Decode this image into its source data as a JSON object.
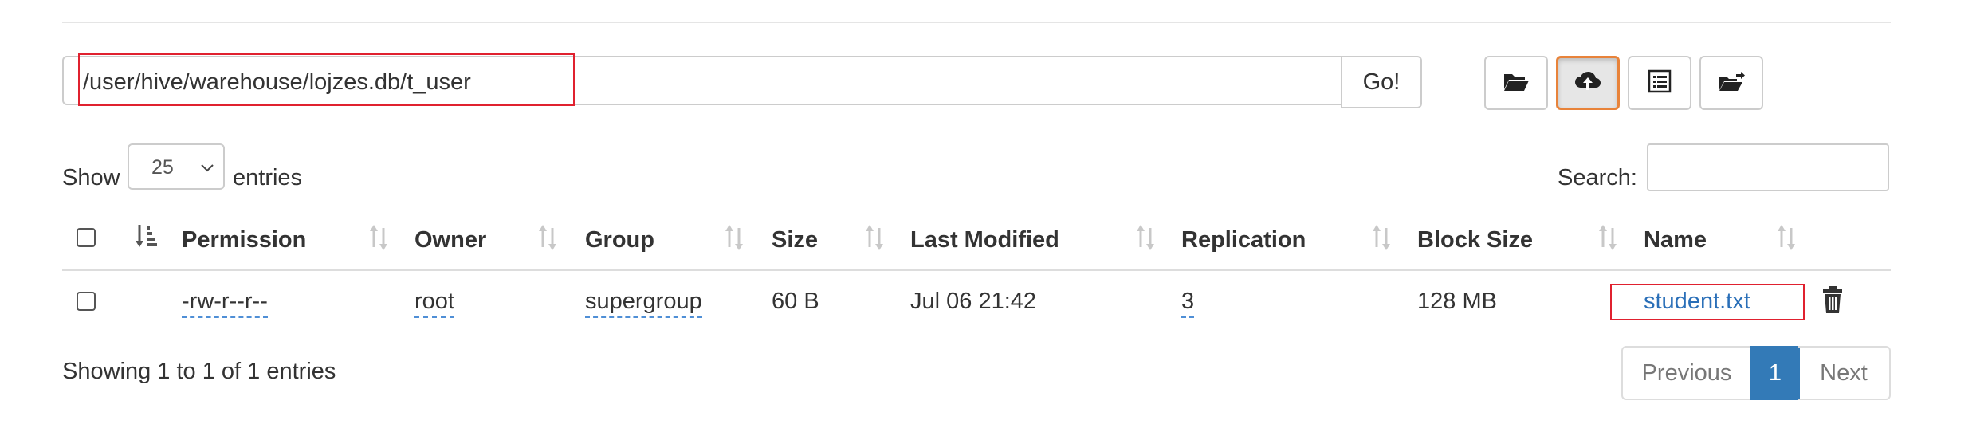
{
  "path_bar": {
    "path_value": "/user/hive/warehouse/lojzes.db/t_user",
    "go_label": "Go!"
  },
  "toolbar": {
    "buttons": [
      {
        "icon": "folder-open-icon",
        "active": false
      },
      {
        "icon": "cloud-upload-icon",
        "active": true
      },
      {
        "icon": "list-icon",
        "active": false
      },
      {
        "icon": "folder-move-icon",
        "active": false
      }
    ],
    "active_color": "#e8833a"
  },
  "length_control": {
    "show_label": "Show",
    "selected": "25",
    "entries_label": "entries"
  },
  "search": {
    "label": "Search:",
    "value": ""
  },
  "table": {
    "columns": [
      "Permission",
      "Owner",
      "Group",
      "Size",
      "Last Modified",
      "Replication",
      "Block Size",
      "Name"
    ],
    "rows": [
      {
        "permission": "-rw-r--r--",
        "owner": "root",
        "group": "supergroup",
        "size": "60 B",
        "last_modified": "Jul 06 21:42",
        "replication": "3",
        "block_size": "128 MB",
        "name": "student.txt"
      }
    ]
  },
  "info": "Showing 1 to 1 of 1 entries",
  "pagination": {
    "previous": "Previous",
    "current": "1",
    "next": "Next",
    "current_color": "#337ab7"
  },
  "highlight_color": "#e0212f"
}
